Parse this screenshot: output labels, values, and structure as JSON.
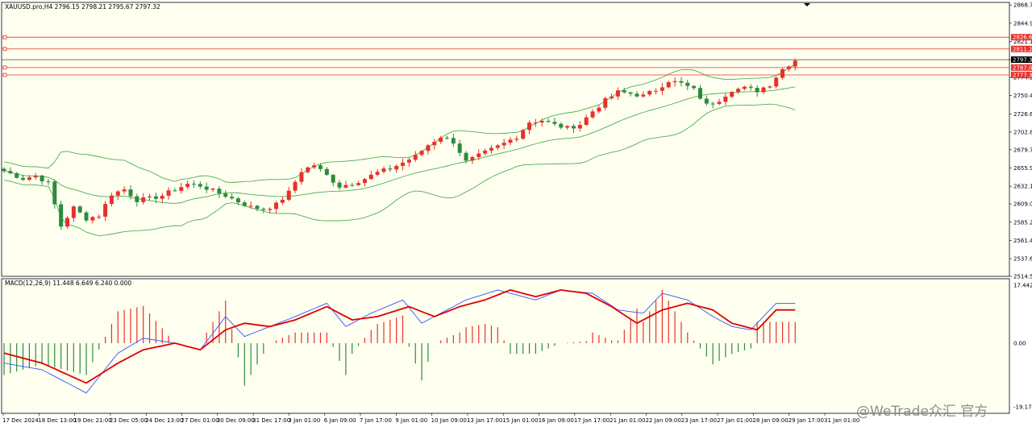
{
  "watermark": "@WeTrade众汇 官方",
  "colors": {
    "bull": "#e8302a",
    "bear": "#2a8c3c",
    "band": "#4caf50",
    "hline": "#e8302a",
    "macd_line": "#3355ff",
    "signal_line": "#e00000",
    "hist_pos": "#e8302a",
    "hist_neg": "#2a8c3c",
    "bg": "#fffff0"
  },
  "chart_data": [
    {
      "type": "candlestick",
      "title": "XAUUSD.pro,H4  2796.15 2798.21 2795.67 2797.32",
      "ylim": [
        2514.5,
        2872
      ],
      "y_ticks": [
        "2868.70",
        "2844.90",
        "2821.10",
        "2797.32",
        "2774.20",
        "2750.40",
        "2726.60",
        "2702.80",
        "2679.70",
        "2655.90",
        "2632.10",
        "2609.00",
        "2585.20",
        "2561.40",
        "2537.60",
        "2514.50"
      ],
      "x_ticks": [
        "17 Dec 2024",
        "18 Dec 13:00",
        "19 Dec 21:00",
        "23 Dec 05:00",
        "24 Dec 13:00",
        "27 Dec 01:00",
        "30 Dec 09:00",
        "31 Dec 17:00",
        "3 Jan 01:00",
        "6 Jan 09:00",
        "7 Jan 17:00",
        "9 Jan 01:00",
        "10 Jan 09:00",
        "13 Jan 17:00",
        "15 Jan 01:00",
        "16 Jan 09:00",
        "17 Jan 17:00",
        "21 Jan 01:00",
        "22 Jan 09:00",
        "23 Jan 17:00",
        "27 Jan 01:00",
        "28 Jan 09:00",
        "29 Jan 17:00",
        "31 Jan 01:00"
      ],
      "price_tags": [
        "2826.61",
        "2811.24",
        "2797.32",
        "2787.00",
        "2777.36"
      ],
      "horizontal_lines": [
        2826.61,
        2811.24,
        2787.0,
        2777.36
      ],
      "current_price": 2797.32,
      "close_anchors": [
        [
          0,
          2652
        ],
        [
          3,
          2642
        ],
        [
          5,
          2646
        ],
        [
          7,
          2636
        ],
        [
          9,
          2580
        ],
        [
          11,
          2604
        ],
        [
          13,
          2590
        ],
        [
          15,
          2594
        ],
        [
          17,
          2622
        ],
        [
          19,
          2628
        ],
        [
          21,
          2614
        ],
        [
          23,
          2616
        ],
        [
          25,
          2620
        ],
        [
          27,
          2628
        ],
        [
          29,
          2635
        ],
        [
          31,
          2633
        ],
        [
          33,
          2626
        ],
        [
          35,
          2620
        ],
        [
          37,
          2612
        ],
        [
          39,
          2605
        ],
        [
          41,
          2602
        ],
        [
          43,
          2608
        ],
        [
          45,
          2624
        ],
        [
          47,
          2652
        ],
        [
          49,
          2660
        ],
        [
          51,
          2646
        ],
        [
          53,
          2632
        ],
        [
          55,
          2636
        ],
        [
          57,
          2642
        ],
        [
          59,
          2650
        ],
        [
          61,
          2655
        ],
        [
          63,
          2663
        ],
        [
          65,
          2671
        ],
        [
          67,
          2686
        ],
        [
          69,
          2697
        ],
        [
          71,
          2690
        ],
        [
          73,
          2664
        ],
        [
          75,
          2672
        ],
        [
          77,
          2680
        ],
        [
          79,
          2688
        ],
        [
          81,
          2697
        ],
        [
          83,
          2716
        ],
        [
          85,
          2718
        ],
        [
          87,
          2712
        ],
        [
          89,
          2708
        ],
        [
          91,
          2713
        ],
        [
          93,
          2730
        ],
        [
          95,
          2744
        ],
        [
          97,
          2755
        ],
        [
          99,
          2753
        ],
        [
          101,
          2750
        ],
        [
          103,
          2758
        ],
        [
          105,
          2770
        ],
        [
          107,
          2766
        ],
        [
          109,
          2758
        ],
        [
          111,
          2738
        ],
        [
          113,
          2745
        ],
        [
          115,
          2758
        ],
        [
          117,
          2760
        ],
        [
          119,
          2757
        ],
        [
          121,
          2765
        ],
        [
          123,
          2785
        ],
        [
          125,
          2797
        ]
      ]
    },
    {
      "type": "line",
      "title": "MACD(12,26,9) 11.448 6.649 6.240 0.000",
      "ylim": [
        -19.172,
        17.442
      ],
      "y_ticks": [
        "17.442",
        "0.00",
        "-19.172"
      ],
      "series": [
        {
          "values_key": "macd",
          "anchors": [
            [
              0,
              -6
            ],
            [
              6,
              -8
            ],
            [
              13,
              -15
            ],
            [
              18,
              -3
            ],
            [
              22,
              1.5
            ],
            [
              27,
              0
            ],
            [
              31,
              -2
            ],
            [
              35,
              8
            ],
            [
              38,
              2
            ],
            [
              42,
              5
            ],
            [
              46,
              8
            ],
            [
              51,
              12
            ],
            [
              54,
              5
            ],
            [
              58,
              9
            ],
            [
              63,
              13
            ],
            [
              66,
              6
            ],
            [
              70,
              10
            ],
            [
              73,
              13
            ],
            [
              78,
              16
            ],
            [
              84,
              13
            ],
            [
              88,
              16
            ],
            [
              93,
              15
            ],
            [
              97,
              10
            ],
            [
              101,
              9
            ],
            [
              104,
              15
            ],
            [
              108,
              13
            ],
            [
              112,
              8
            ],
            [
              115,
              5
            ],
            [
              118,
              4
            ],
            [
              122,
              12
            ]
          ]
        },
        {
          "values_key": "signal",
          "anchors": [
            [
              0,
              -3
            ],
            [
              6,
              -6
            ],
            [
              13,
              -12
            ],
            [
              18,
              -6
            ],
            [
              22,
              -2
            ],
            [
              27,
              0
            ],
            [
              31,
              -2
            ],
            [
              35,
              4
            ],
            [
              38,
              6
            ],
            [
              42,
              5
            ],
            [
              46,
              7
            ],
            [
              51,
              11
            ],
            [
              55,
              7
            ],
            [
              59,
              8
            ],
            [
              64,
              11
            ],
            [
              68,
              8
            ],
            [
              72,
              11
            ],
            [
              76,
              13
            ],
            [
              80,
              16
            ],
            [
              84,
              14
            ],
            [
              88,
              16
            ],
            [
              92,
              15
            ],
            [
              96,
              11
            ],
            [
              100,
              6
            ],
            [
              104,
              10
            ],
            [
              108,
              12
            ],
            [
              112,
              10
            ],
            [
              115,
              6
            ],
            [
              119,
              4
            ],
            [
              122,
              10
            ]
          ]
        }
      ]
    }
  ]
}
